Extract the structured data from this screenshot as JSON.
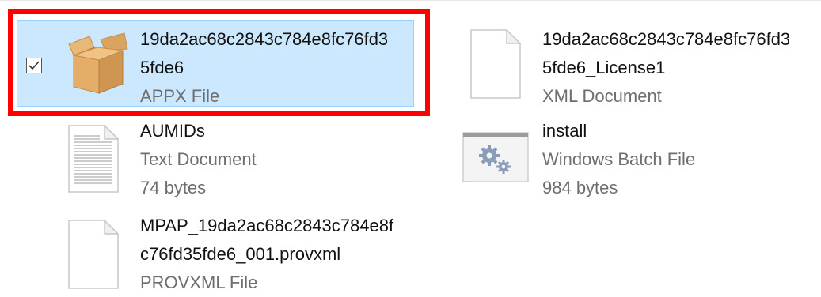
{
  "files": [
    {
      "id": "appx",
      "name_line1": "19da2ac68c2843c784e8fc76fd3",
      "name_line2": "5fde6",
      "type": "APPX File",
      "size": "",
      "selected": true,
      "icon": "package-box-icon"
    },
    {
      "id": "license",
      "name_line1": "19da2ac68c2843c784e8fc76fd3",
      "name_line2": "5fde6_License1",
      "type": "XML Document",
      "size": "",
      "selected": false,
      "icon": "blank-document-icon"
    },
    {
      "id": "aumids",
      "name_line1": "AUMIDs",
      "name_line2": "",
      "type": "Text Document",
      "size": "74 bytes",
      "selected": false,
      "icon": "text-document-icon"
    },
    {
      "id": "install",
      "name_line1": "install",
      "name_line2": "",
      "type": "Windows Batch File",
      "size": "984 bytes",
      "selected": false,
      "icon": "batch-gears-icon"
    },
    {
      "id": "mpap",
      "name_line1": "MPAP_19da2ac68c2843c784e8f",
      "name_line2": "c76fd35fde6_001.provxml",
      "type": "PROVXML File",
      "size": "",
      "selected": false,
      "icon": "blank-document-icon"
    }
  ],
  "colors": {
    "selection_bg": "#cce8ff",
    "selection_border": "#99d1ff",
    "highlight": "#ff0000",
    "secondary_text": "#6e6e6e"
  }
}
